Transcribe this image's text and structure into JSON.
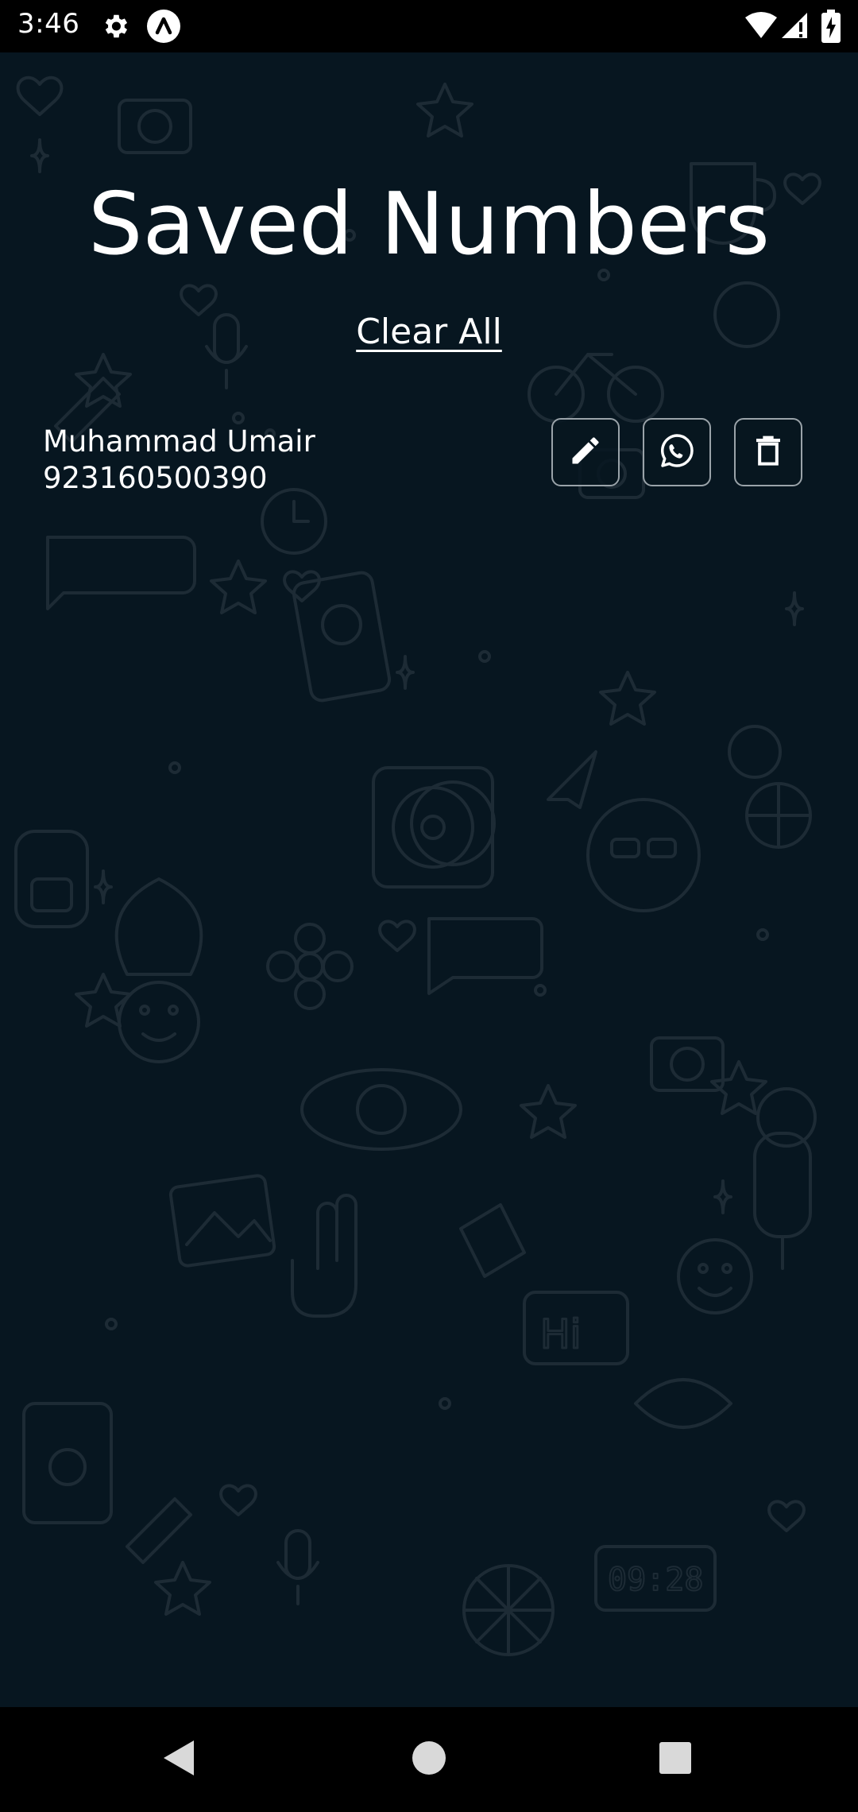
{
  "status_bar": {
    "time": "3:46",
    "icons": [
      "settings-icon",
      "app-notification-icon",
      "wifi-icon",
      "signal-icon",
      "battery-charging-icon"
    ]
  },
  "page": {
    "title": "Saved Numbers",
    "clear_all_label": "Clear All"
  },
  "contacts": [
    {
      "name": "Muhammad Umair",
      "number": "923160500390",
      "actions": [
        "edit-icon",
        "whatsapp-icon",
        "delete-icon"
      ]
    }
  ],
  "nav_bar": {
    "buttons": [
      "back-icon",
      "home-icon",
      "recents-icon"
    ]
  },
  "colors": {
    "background": "#071620",
    "doodle_stroke": "#1d2b35",
    "text": "#ffffff",
    "button_border": "#9aa3a9",
    "system_bars": "#000000"
  }
}
